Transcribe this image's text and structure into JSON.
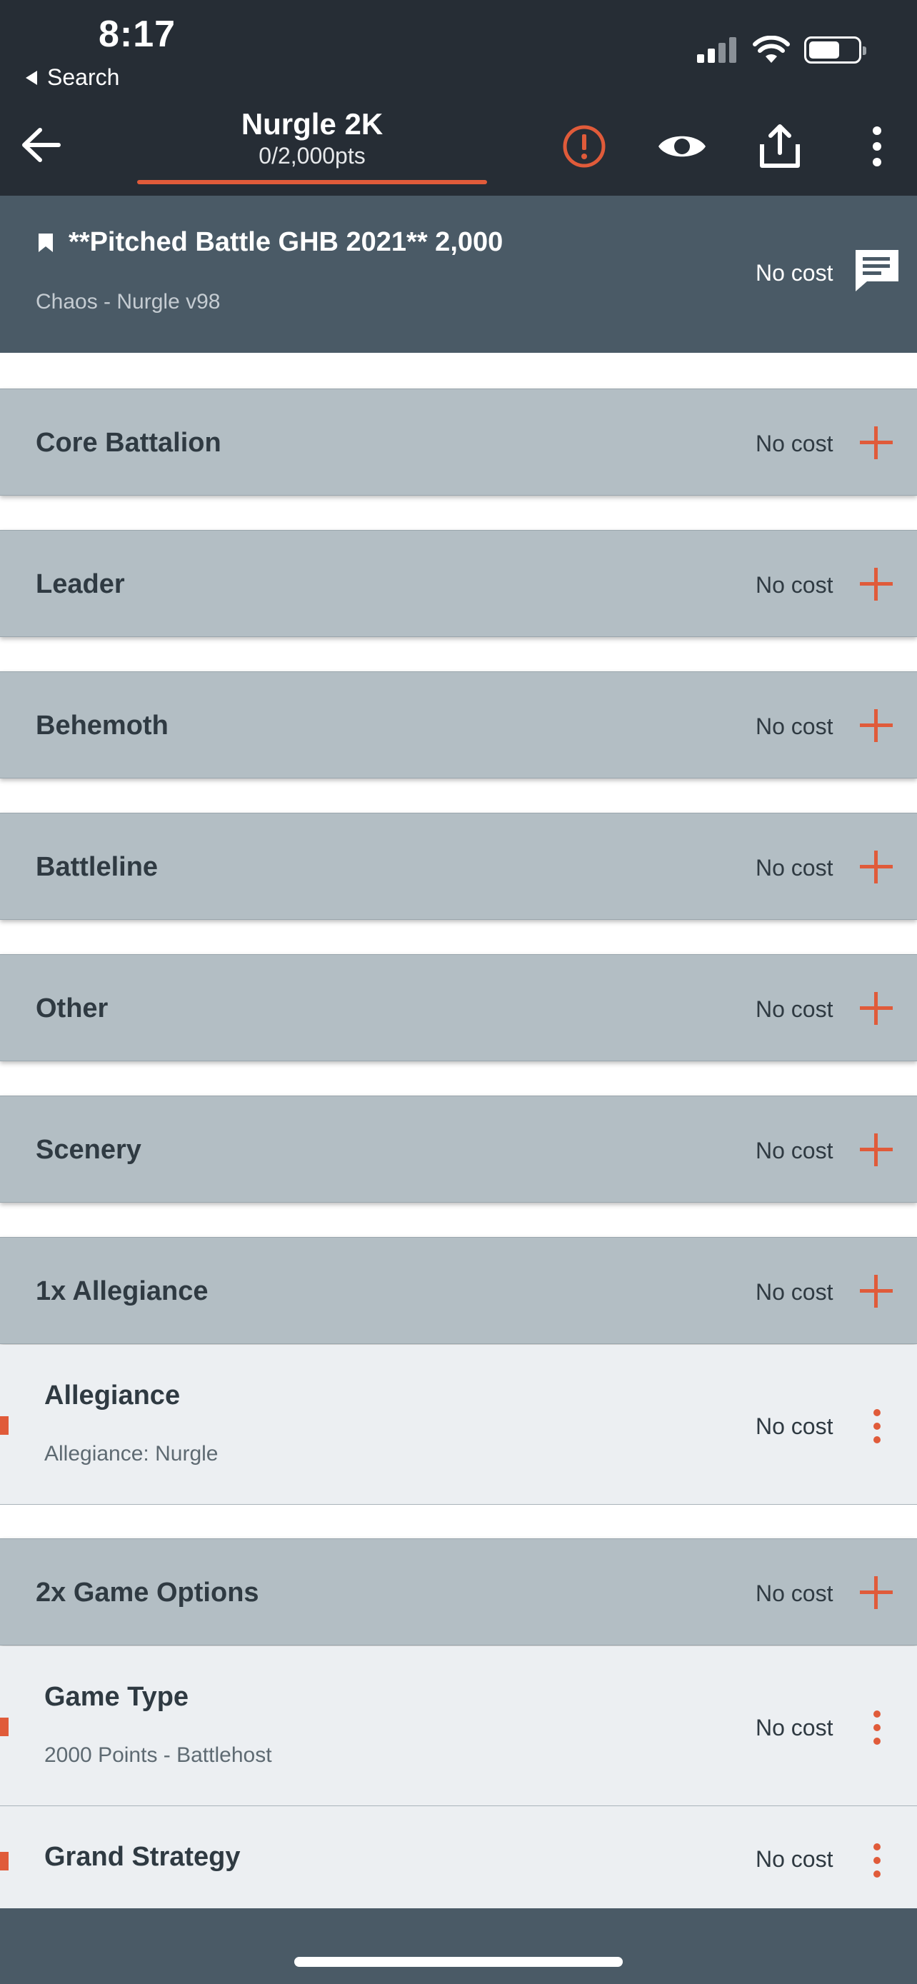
{
  "status_bar": {
    "time": "8:17",
    "back_app": "Search"
  },
  "nav": {
    "title": "Nurgle 2K",
    "points": "0/2,000pts",
    "icons": [
      "arrow-left-icon",
      "alert-circle-icon",
      "eye-icon",
      "share-icon",
      "more-vertical-icon"
    ]
  },
  "roster": {
    "name": "**Pitched Battle GHB 2021** 2,000",
    "subtitle": "Chaos - Nurgle v98",
    "cost": "No cost"
  },
  "categories": [
    {
      "label": "Core Battalion",
      "cost": "No cost"
    },
    {
      "label": "Leader",
      "cost": "No cost"
    },
    {
      "label": "Behemoth",
      "cost": "No cost"
    },
    {
      "label": "Battleline",
      "cost": "No cost"
    },
    {
      "label": "Other",
      "cost": "No cost"
    },
    {
      "label": "Scenery",
      "cost": "No cost"
    },
    {
      "label": "1x Allegiance",
      "cost": "No cost"
    },
    {
      "label": "2x Game Options",
      "cost": "No cost"
    }
  ],
  "entries": [
    {
      "name": "Allegiance",
      "sub": "Allegiance: Nurgle",
      "cost": "No cost"
    },
    {
      "name": "Game Type",
      "sub": "2000 Points - Battlehost",
      "cost": "No cost"
    },
    {
      "name": "Grand Strategy",
      "sub": "",
      "cost": "No cost"
    }
  ],
  "colors": {
    "accent": "#e05b3a",
    "header_bg": "#262d35",
    "roster_bg": "#4a5a66",
    "category_bg": "#b3bec4",
    "entry_bg": "#eceff2"
  }
}
